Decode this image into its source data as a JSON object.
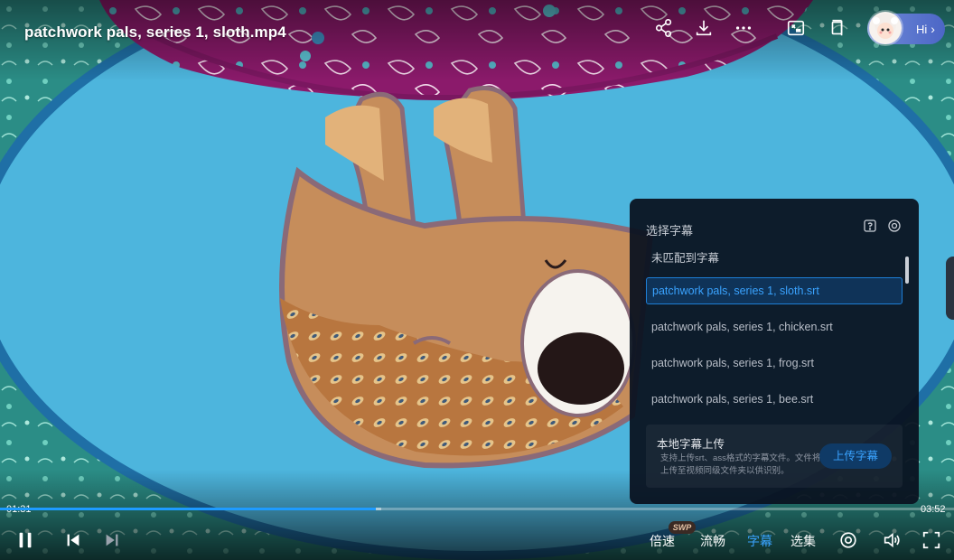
{
  "video": {
    "title": "patchwork pals, series 1, sloth.mp4"
  },
  "topbar": {
    "user_greeting": "Hi"
  },
  "subtitle_panel": {
    "title": "选择字幕",
    "no_match": "未匹配到字幕",
    "items": [
      {
        "label": "patchwork pals, series 1, sloth.srt",
        "active": true
      },
      {
        "label": "patchwork pals, series 1, chicken.srt",
        "active": false
      },
      {
        "label": "patchwork pals, series 1, frog.srt",
        "active": false
      },
      {
        "label": "patchwork pals, series 1, bee.srt",
        "active": false
      }
    ],
    "upload": {
      "title": "本地字幕上传",
      "description": "支持上传srt、ass格式的字幕文件。文件将上传至视频同级文件夹以供识别。",
      "button": "上传字幕"
    }
  },
  "player": {
    "current_time": "01:31",
    "total_time": "03:52",
    "progress_fraction": 0.394,
    "buffer_fraction": 0.4,
    "controls": {
      "speed": "倍速",
      "speed_badge": "SWP",
      "quality": "流畅",
      "subtitle": "字幕",
      "episodes": "选集"
    }
  },
  "colors": {
    "accent": "#1e9bff",
    "panel_bg": "#0a1220",
    "active_item_bg": "#0f3358",
    "background_blue": "#4db5dd",
    "fabric_purple": "#8b1a6b"
  }
}
